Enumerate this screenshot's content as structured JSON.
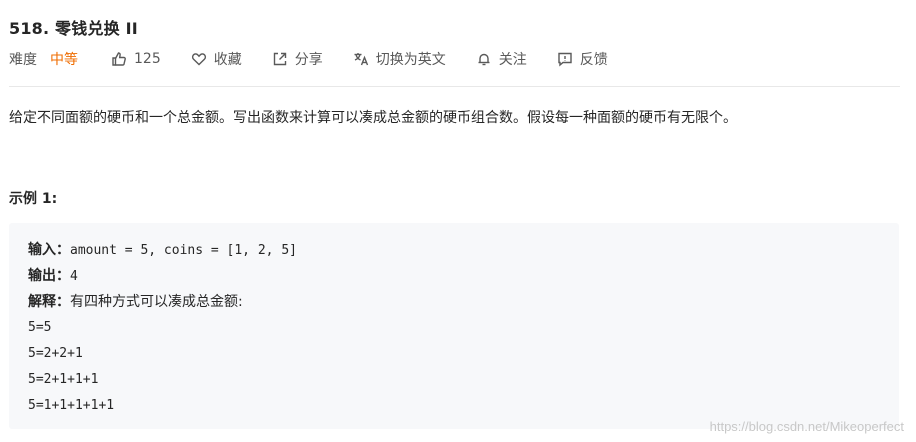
{
  "problem": {
    "title": "518. 零钱兑换 II",
    "difficulty_label": "难度",
    "difficulty_value": "中等",
    "likes": "125",
    "actions": {
      "collect": "收藏",
      "share": "分享",
      "translate": "切换为英文",
      "follow": "关注",
      "feedback": "反馈"
    },
    "description": "给定不同面额的硬币和一个总金额。写出函数来计算可以凑成总金额的硬币组合数。假设每一种面额的硬币有无限个。",
    "example_title": "示例 1:",
    "example": {
      "input_label": "输入：",
      "input_value": "amount = 5, coins = [1, 2, 5]",
      "output_label": "输出：",
      "output_value": "4",
      "explain_label": "解释：",
      "explain_value": "有四种方式可以凑成总金额:",
      "lines": [
        "5=5",
        "5=2+2+1",
        "5=2+1+1+1",
        "5=1+1+1+1+1"
      ]
    }
  },
  "watermark": "https://blog.csdn.net/Mikeoperfect",
  "colors": {
    "difficulty": "#ef6c00",
    "code_bg": "#f7f8fa"
  }
}
